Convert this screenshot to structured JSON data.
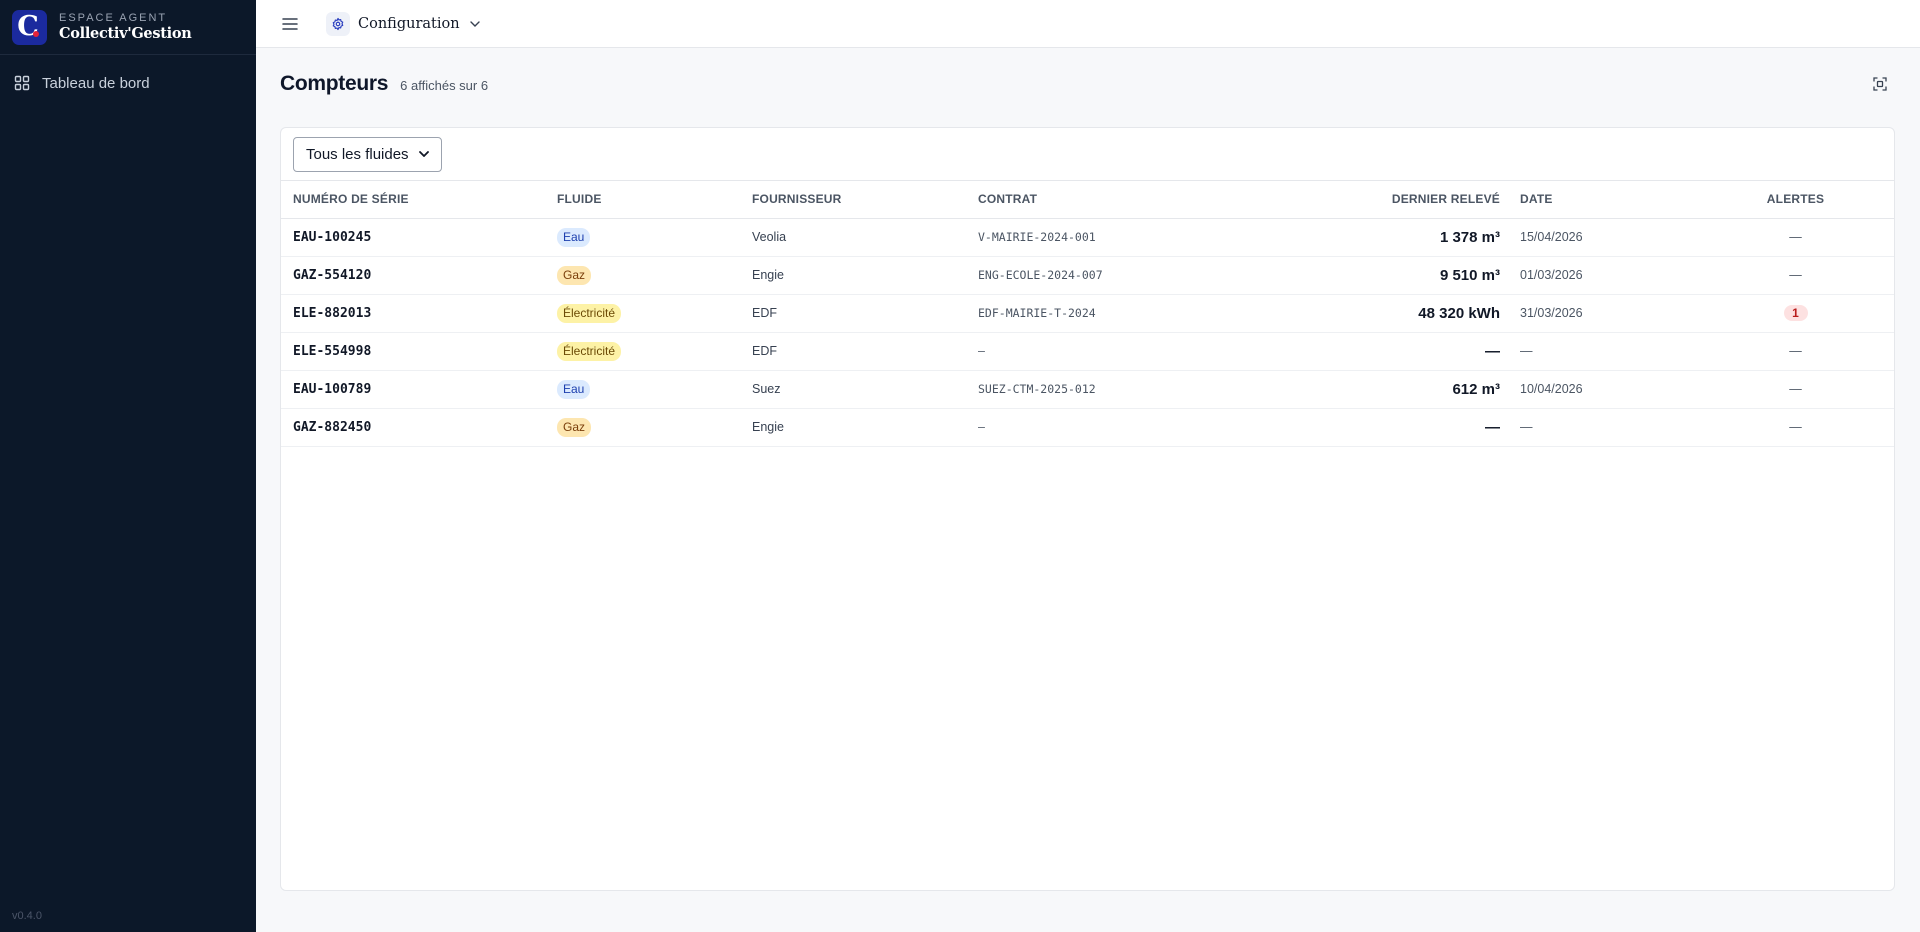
{
  "brand": {
    "subtitle": "ESPACE AGENT",
    "name": "Collectiv'Gestion",
    "logo_letter": "C"
  },
  "sidebar": {
    "items": [
      {
        "label": "Tableau de bord",
        "icon": "dashboard-grid-icon"
      }
    ],
    "version": "v0.4.0"
  },
  "topbar": {
    "section_label": "Configuration",
    "section_icon": "gear-icon"
  },
  "page": {
    "title": "Compteurs",
    "count_text": "6 affichés sur 6"
  },
  "filter": {
    "selected": "Tous les fluides"
  },
  "table": {
    "headers": [
      "Numéro de série",
      "Fluide",
      "Fournisseur",
      "Contrat",
      "Dernier relevé",
      "Date",
      "Alertes"
    ],
    "rows": [
      {
        "serial": "EAU-100245",
        "fluid": "Eau",
        "fluid_kind": "eau",
        "provider": "Veolia",
        "contract": "V-MAIRIE-2024-001",
        "reading": "1 378 m³",
        "date": "15/04/2026",
        "alerts": "—",
        "alert_count": 0
      },
      {
        "serial": "GAZ-554120",
        "fluid": "Gaz",
        "fluid_kind": "gaz",
        "provider": "Engie",
        "contract": "ENG-ECOLE-2024-007",
        "reading": "9 510 m³",
        "date": "01/03/2026",
        "alerts": "—",
        "alert_count": 0
      },
      {
        "serial": "ELE-882013",
        "fluid": "Électricité",
        "fluid_kind": "ele",
        "provider": "EDF",
        "contract": "EDF-MAIRIE-T-2024",
        "reading": "48 320 kWh",
        "date": "31/03/2026",
        "alerts": "1",
        "alert_count": 1
      },
      {
        "serial": "ELE-554998",
        "fluid": "Électricité",
        "fluid_kind": "ele",
        "provider": "EDF",
        "contract": "—",
        "reading": "—",
        "date": "—",
        "alerts": "—",
        "alert_count": 0
      },
      {
        "serial": "EAU-100789",
        "fluid": "Eau",
        "fluid_kind": "eau",
        "provider": "Suez",
        "contract": "SUEZ-CTM-2025-012",
        "reading": "612 m³",
        "date": "10/04/2026",
        "alerts": "—",
        "alert_count": 0
      },
      {
        "serial": "GAZ-882450",
        "fluid": "Gaz",
        "fluid_kind": "gaz",
        "provider": "Engie",
        "contract": "—",
        "reading": "—",
        "date": "—",
        "alerts": "—",
        "alert_count": 0
      }
    ]
  },
  "colors": {
    "sidebar_bg": "#0c1829",
    "logo_bg": "#1b2a9e",
    "logo_dot": "#e4233a",
    "eau": "#dbeafe",
    "gaz": "#fde6b0",
    "ele": "#fdf2a6",
    "alert": "#fde1e1"
  }
}
